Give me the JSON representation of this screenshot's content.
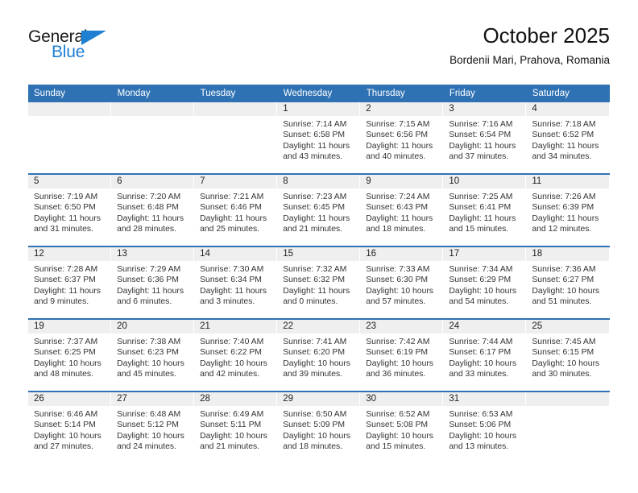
{
  "brand": {
    "word_one": "General",
    "word_two": "Blue",
    "logo_icon": "triangle-icon"
  },
  "header": {
    "title": "October 2025",
    "location": "Bordenii Mari, Prahova, Romania"
  },
  "colors": {
    "header_blue": "#2f72b3",
    "daynum_gray": "#efefef",
    "brand_blue": "#1f7fd1",
    "text": "#333333"
  },
  "weekday_headers": [
    "Sunday",
    "Monday",
    "Tuesday",
    "Wednesday",
    "Thursday",
    "Friday",
    "Saturday"
  ],
  "labels": {
    "sunrise": "Sunrise:",
    "sunset": "Sunset:",
    "daylight": "Daylight:"
  },
  "weeks": [
    [
      {
        "day": ""
      },
      {
        "day": ""
      },
      {
        "day": ""
      },
      {
        "day": "1",
        "sunrise": "Sunrise: 7:14 AM",
        "sunset": "Sunset: 6:58 PM",
        "daylight1": "Daylight: 11 hours",
        "daylight2": "and 43 minutes."
      },
      {
        "day": "2",
        "sunrise": "Sunrise: 7:15 AM",
        "sunset": "Sunset: 6:56 PM",
        "daylight1": "Daylight: 11 hours",
        "daylight2": "and 40 minutes."
      },
      {
        "day": "3",
        "sunrise": "Sunrise: 7:16 AM",
        "sunset": "Sunset: 6:54 PM",
        "daylight1": "Daylight: 11 hours",
        "daylight2": "and 37 minutes."
      },
      {
        "day": "4",
        "sunrise": "Sunrise: 7:18 AM",
        "sunset": "Sunset: 6:52 PM",
        "daylight1": "Daylight: 11 hours",
        "daylight2": "and 34 minutes."
      }
    ],
    [
      {
        "day": "5",
        "sunrise": "Sunrise: 7:19 AM",
        "sunset": "Sunset: 6:50 PM",
        "daylight1": "Daylight: 11 hours",
        "daylight2": "and 31 minutes."
      },
      {
        "day": "6",
        "sunrise": "Sunrise: 7:20 AM",
        "sunset": "Sunset: 6:48 PM",
        "daylight1": "Daylight: 11 hours",
        "daylight2": "and 28 minutes."
      },
      {
        "day": "7",
        "sunrise": "Sunrise: 7:21 AM",
        "sunset": "Sunset: 6:46 PM",
        "daylight1": "Daylight: 11 hours",
        "daylight2": "and 25 minutes."
      },
      {
        "day": "8",
        "sunrise": "Sunrise: 7:23 AM",
        "sunset": "Sunset: 6:45 PM",
        "daylight1": "Daylight: 11 hours",
        "daylight2": "and 21 minutes."
      },
      {
        "day": "9",
        "sunrise": "Sunrise: 7:24 AM",
        "sunset": "Sunset: 6:43 PM",
        "daylight1": "Daylight: 11 hours",
        "daylight2": "and 18 minutes."
      },
      {
        "day": "10",
        "sunrise": "Sunrise: 7:25 AM",
        "sunset": "Sunset: 6:41 PM",
        "daylight1": "Daylight: 11 hours",
        "daylight2": "and 15 minutes."
      },
      {
        "day": "11",
        "sunrise": "Sunrise: 7:26 AM",
        "sunset": "Sunset: 6:39 PM",
        "daylight1": "Daylight: 11 hours",
        "daylight2": "and 12 minutes."
      }
    ],
    [
      {
        "day": "12",
        "sunrise": "Sunrise: 7:28 AM",
        "sunset": "Sunset: 6:37 PM",
        "daylight1": "Daylight: 11 hours",
        "daylight2": "and 9 minutes."
      },
      {
        "day": "13",
        "sunrise": "Sunrise: 7:29 AM",
        "sunset": "Sunset: 6:36 PM",
        "daylight1": "Daylight: 11 hours",
        "daylight2": "and 6 minutes."
      },
      {
        "day": "14",
        "sunrise": "Sunrise: 7:30 AM",
        "sunset": "Sunset: 6:34 PM",
        "daylight1": "Daylight: 11 hours",
        "daylight2": "and 3 minutes."
      },
      {
        "day": "15",
        "sunrise": "Sunrise: 7:32 AM",
        "sunset": "Sunset: 6:32 PM",
        "daylight1": "Daylight: 11 hours",
        "daylight2": "and 0 minutes."
      },
      {
        "day": "16",
        "sunrise": "Sunrise: 7:33 AM",
        "sunset": "Sunset: 6:30 PM",
        "daylight1": "Daylight: 10 hours",
        "daylight2": "and 57 minutes."
      },
      {
        "day": "17",
        "sunrise": "Sunrise: 7:34 AM",
        "sunset": "Sunset: 6:29 PM",
        "daylight1": "Daylight: 10 hours",
        "daylight2": "and 54 minutes."
      },
      {
        "day": "18",
        "sunrise": "Sunrise: 7:36 AM",
        "sunset": "Sunset: 6:27 PM",
        "daylight1": "Daylight: 10 hours",
        "daylight2": "and 51 minutes."
      }
    ],
    [
      {
        "day": "19",
        "sunrise": "Sunrise: 7:37 AM",
        "sunset": "Sunset: 6:25 PM",
        "daylight1": "Daylight: 10 hours",
        "daylight2": "and 48 minutes."
      },
      {
        "day": "20",
        "sunrise": "Sunrise: 7:38 AM",
        "sunset": "Sunset: 6:23 PM",
        "daylight1": "Daylight: 10 hours",
        "daylight2": "and 45 minutes."
      },
      {
        "day": "21",
        "sunrise": "Sunrise: 7:40 AM",
        "sunset": "Sunset: 6:22 PM",
        "daylight1": "Daylight: 10 hours",
        "daylight2": "and 42 minutes."
      },
      {
        "day": "22",
        "sunrise": "Sunrise: 7:41 AM",
        "sunset": "Sunset: 6:20 PM",
        "daylight1": "Daylight: 10 hours",
        "daylight2": "and 39 minutes."
      },
      {
        "day": "23",
        "sunrise": "Sunrise: 7:42 AM",
        "sunset": "Sunset: 6:19 PM",
        "daylight1": "Daylight: 10 hours",
        "daylight2": "and 36 minutes."
      },
      {
        "day": "24",
        "sunrise": "Sunrise: 7:44 AM",
        "sunset": "Sunset: 6:17 PM",
        "daylight1": "Daylight: 10 hours",
        "daylight2": "and 33 minutes."
      },
      {
        "day": "25",
        "sunrise": "Sunrise: 7:45 AM",
        "sunset": "Sunset: 6:15 PM",
        "daylight1": "Daylight: 10 hours",
        "daylight2": "and 30 minutes."
      }
    ],
    [
      {
        "day": "26",
        "sunrise": "Sunrise: 6:46 AM",
        "sunset": "Sunset: 5:14 PM",
        "daylight1": "Daylight: 10 hours",
        "daylight2": "and 27 minutes."
      },
      {
        "day": "27",
        "sunrise": "Sunrise: 6:48 AM",
        "sunset": "Sunset: 5:12 PM",
        "daylight1": "Daylight: 10 hours",
        "daylight2": "and 24 minutes."
      },
      {
        "day": "28",
        "sunrise": "Sunrise: 6:49 AM",
        "sunset": "Sunset: 5:11 PM",
        "daylight1": "Daylight: 10 hours",
        "daylight2": "and 21 minutes."
      },
      {
        "day": "29",
        "sunrise": "Sunrise: 6:50 AM",
        "sunset": "Sunset: 5:09 PM",
        "daylight1": "Daylight: 10 hours",
        "daylight2": "and 18 minutes."
      },
      {
        "day": "30",
        "sunrise": "Sunrise: 6:52 AM",
        "sunset": "Sunset: 5:08 PM",
        "daylight1": "Daylight: 10 hours",
        "daylight2": "and 15 minutes."
      },
      {
        "day": "31",
        "sunrise": "Sunrise: 6:53 AM",
        "sunset": "Sunset: 5:06 PM",
        "daylight1": "Daylight: 10 hours",
        "daylight2": "and 13 minutes."
      },
      {
        "day": ""
      }
    ]
  ]
}
